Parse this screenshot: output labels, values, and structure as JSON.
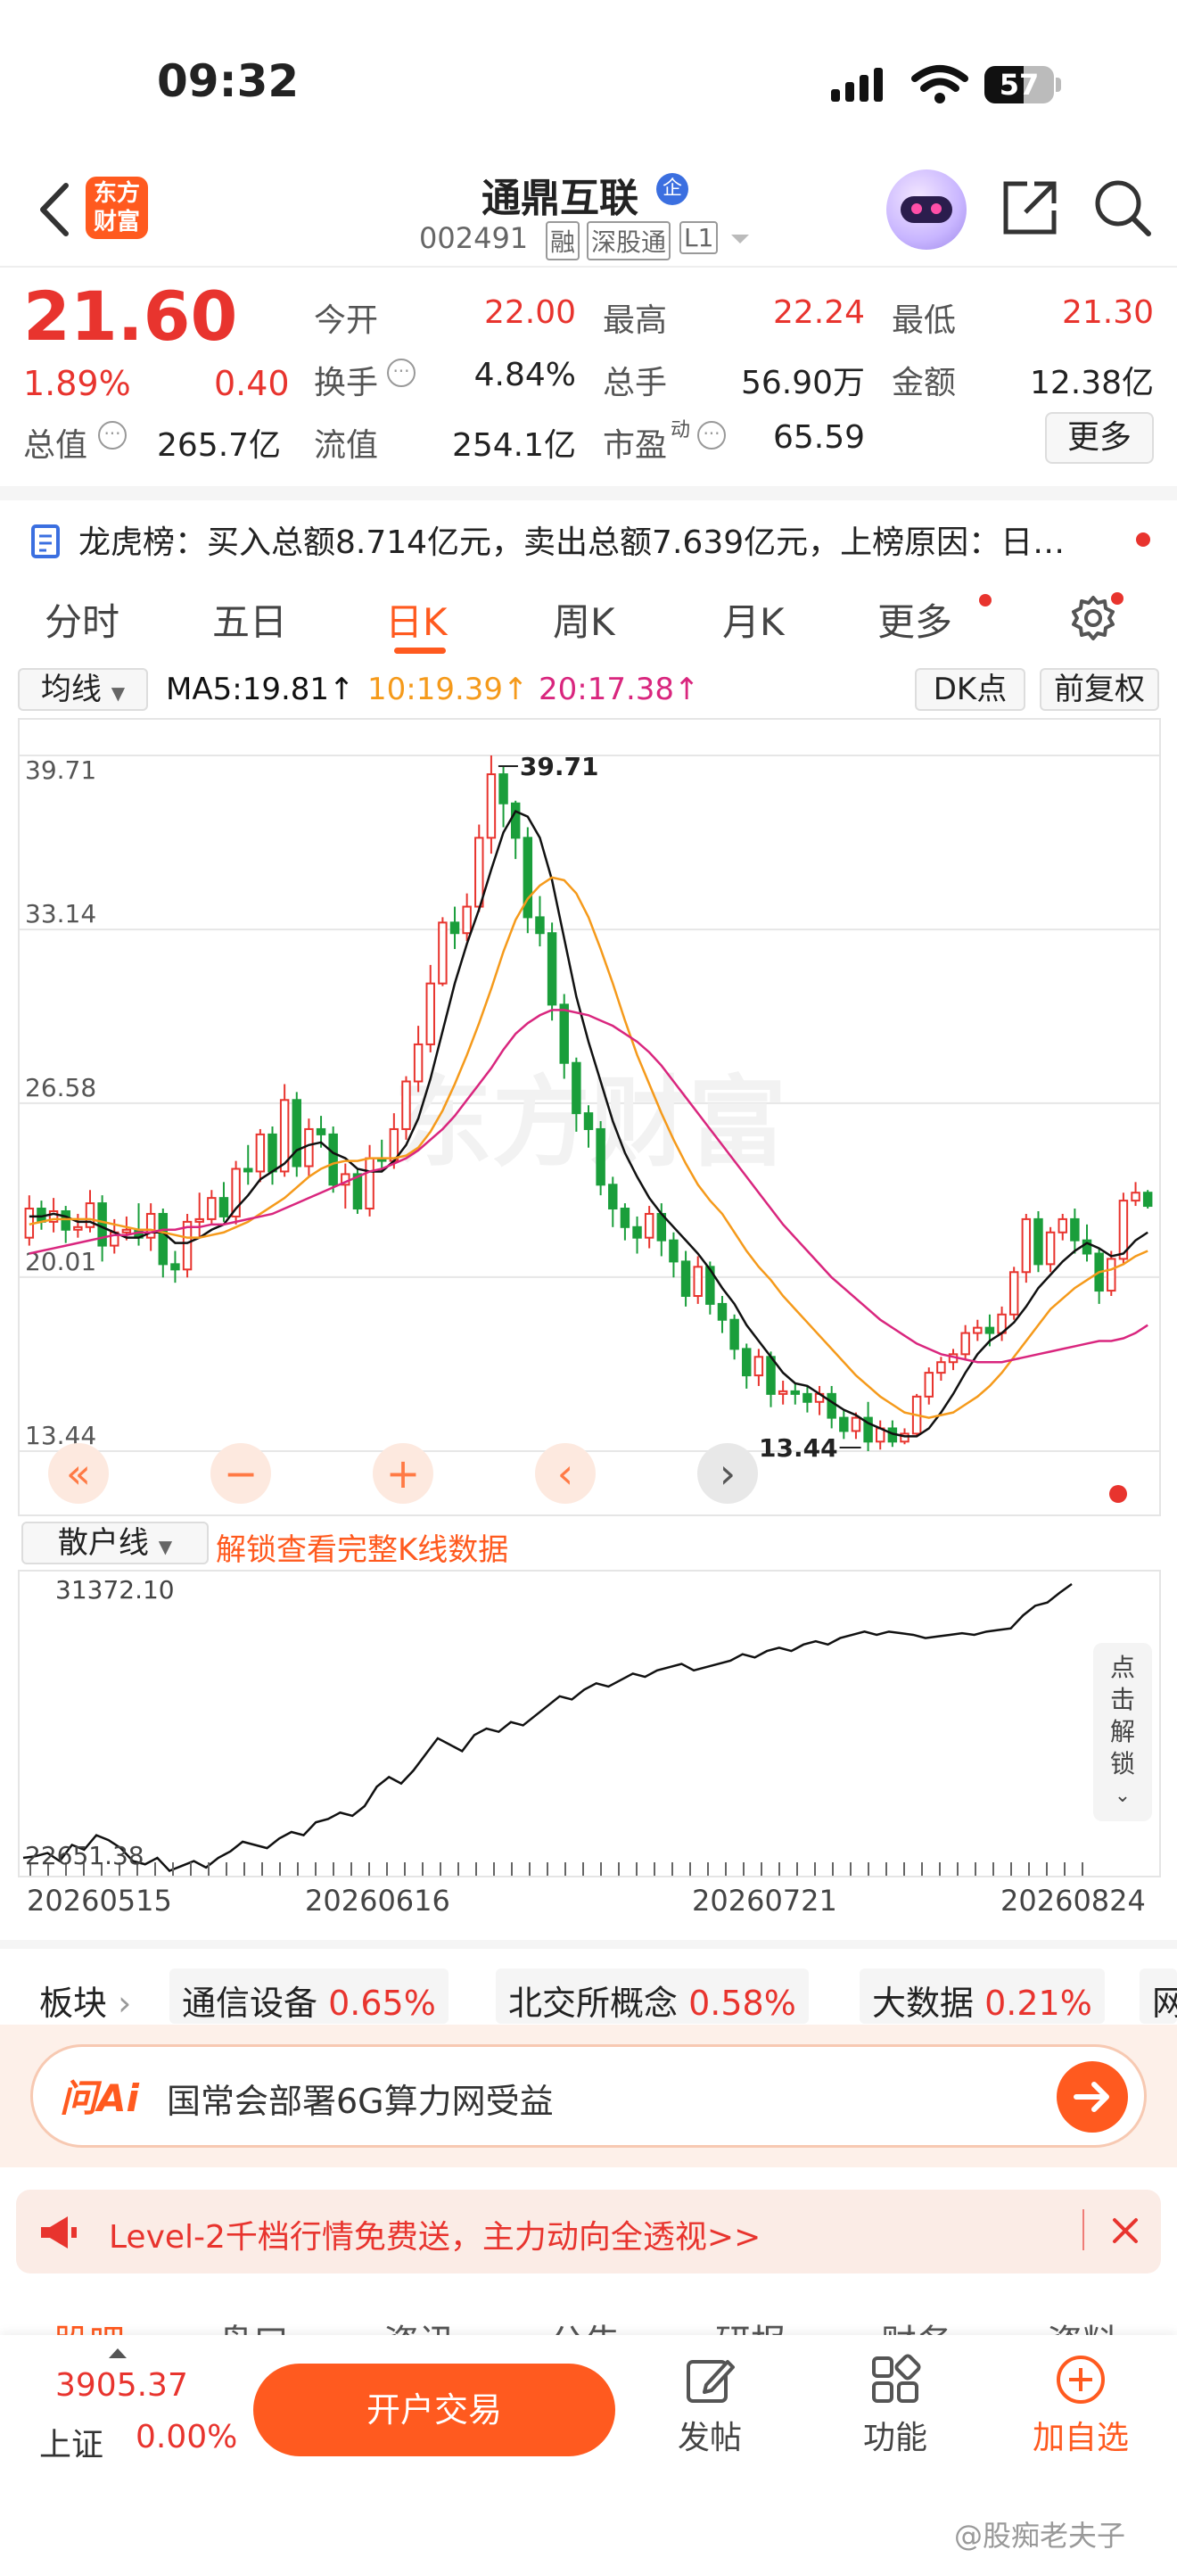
{
  "status_bar": {
    "time": "09:32",
    "battery": "57"
  },
  "header": {
    "logo_line1": "东方",
    "logo_line2": "财富",
    "stock_name": "通鼎互联",
    "qi_badge": "企",
    "code": "002491",
    "tags": [
      "融",
      "深股通",
      "L1"
    ]
  },
  "quote": {
    "price": "21.60",
    "change_pct": "1.89%",
    "change": "0.40",
    "total_value_label": "总值",
    "total_value": "265.7亿",
    "fields": [
      {
        "label": "今开",
        "value": "22.00"
      },
      {
        "label": "最高",
        "value": "22.24"
      },
      {
        "label": "最低",
        "value": "21.30"
      },
      {
        "label": "换手",
        "value": "4.84%"
      },
      {
        "label": "总手",
        "value": "56.90万"
      },
      {
        "label": "金额",
        "value": "12.38亿"
      },
      {
        "label": "流值",
        "value": "254.1亿"
      },
      {
        "label": "市盈",
        "value": "65.59"
      }
    ],
    "pe_sup": "动",
    "more": "更多"
  },
  "notice": {
    "text": "龙虎榜：买入总额8.714亿元，卖出总额7.639亿元，上榜原因：日…"
  },
  "tabs": [
    "分时",
    "五日",
    "日K",
    "周K",
    "月K",
    "更多"
  ],
  "active_tab": "日K",
  "chart_header": {
    "ma_select": "均线",
    "ma5": "MA5:19.81↑",
    "ma10": "10:19.39↑",
    "ma20": "20:17.38↑",
    "dk": "DK点",
    "adjust": "前复权"
  },
  "colors": {
    "up": "#e8342e",
    "down": "#1a9e3b",
    "ma5": "#111111",
    "ma10": "#f59a1b",
    "ma20": "#d9267e",
    "accent": "#ff5a1f"
  },
  "chart_data": {
    "type": "candlestick",
    "y_ticks": [
      "39.71",
      "33.14",
      "26.58",
      "20.01",
      "13.44"
    ],
    "ylim": [
      13.44,
      39.71
    ],
    "high_label": "39.71",
    "low_label": "13.44",
    "watermark": "东方财富",
    "candles": [
      [
        21.5,
        22.6,
        23.1,
        21.2
      ],
      [
        22.6,
        22.1,
        22.9,
        21.8
      ],
      [
        22.1,
        22.5,
        23.0,
        21.7
      ],
      [
        22.5,
        21.8,
        22.7,
        21.3
      ],
      [
        21.8,
        21.9,
        22.4,
        21.5
      ],
      [
        21.9,
        22.8,
        23.3,
        21.7
      ],
      [
        22.8,
        21.2,
        23.1,
        20.6
      ],
      [
        21.2,
        21.7,
        22.2,
        20.9
      ],
      [
        21.7,
        21.8,
        22.3,
        21.4
      ],
      [
        21.8,
        21.5,
        22.8,
        21.2
      ],
      [
        21.5,
        22.4,
        22.8,
        21.0
      ],
      [
        22.4,
        20.5,
        22.6,
        20.0
      ],
      [
        20.5,
        20.3,
        21.0,
        19.8
      ],
      [
        20.3,
        22.1,
        22.4,
        20.0
      ],
      [
        22.1,
        22.2,
        23.2,
        21.5
      ],
      [
        22.2,
        23.0,
        23.3,
        22.0
      ],
      [
        23.0,
        22.3,
        23.6,
        22.1
      ],
      [
        22.3,
        24.1,
        24.4,
        22.0
      ],
      [
        24.1,
        24.0,
        25.0,
        23.5
      ],
      [
        24.0,
        25.4,
        25.6,
        23.6
      ],
      [
        25.4,
        24.0,
        25.7,
        23.5
      ],
      [
        24.0,
        26.7,
        27.3,
        23.8
      ],
      [
        26.7,
        24.2,
        27.0,
        23.8
      ],
      [
        24.2,
        25.6,
        26.0,
        23.8
      ],
      [
        25.6,
        25.4,
        26.1,
        24.9
      ],
      [
        25.4,
        23.5,
        25.7,
        23.2
      ],
      [
        23.5,
        23.9,
        24.3,
        22.6
      ],
      [
        23.9,
        22.6,
        24.1,
        22.4
      ],
      [
        22.6,
        24.5,
        25.0,
        22.3
      ],
      [
        24.5,
        24.4,
        25.2,
        24.0
      ],
      [
        24.4,
        25.6,
        26.2,
        24.1
      ],
      [
        25.6,
        27.4,
        27.6,
        25.2
      ],
      [
        27.4,
        28.8,
        29.5,
        27.0
      ],
      [
        28.8,
        31.1,
        31.8,
        28.5
      ],
      [
        31.1,
        33.4,
        33.6,
        31.0
      ],
      [
        33.4,
        33.0,
        34.0,
        32.4
      ],
      [
        33.0,
        34.0,
        34.5,
        32.7
      ],
      [
        34.0,
        36.6,
        37.1,
        33.8
      ],
      [
        36.6,
        39.0,
        39.71,
        36.0
      ],
      [
        39.0,
        37.9,
        39.3,
        37.0
      ],
      [
        37.9,
        36.6,
        38.0,
        35.8
      ],
      [
        36.6,
        33.6,
        37.0,
        33.0
      ],
      [
        33.6,
        33.0,
        34.4,
        32.5
      ],
      [
        33.0,
        30.3,
        33.4,
        29.7
      ],
      [
        30.3,
        28.1,
        30.7,
        27.5
      ],
      [
        28.1,
        26.2,
        28.3,
        25.5
      ],
      [
        26.2,
        25.6,
        26.5,
        24.9
      ],
      [
        25.6,
        23.5,
        25.9,
        23.1
      ],
      [
        23.5,
        22.6,
        23.8,
        21.9
      ],
      [
        22.6,
        21.9,
        22.8,
        21.4
      ],
      [
        21.9,
        21.5,
        22.3,
        20.9
      ],
      [
        21.5,
        22.4,
        22.7,
        21.1
      ],
      [
        22.4,
        21.4,
        22.8,
        20.8
      ],
      [
        21.4,
        20.6,
        21.7,
        20.0
      ],
      [
        20.6,
        19.3,
        21.0,
        18.9
      ],
      [
        19.3,
        20.4,
        20.8,
        19.0
      ],
      [
        20.4,
        19.0,
        20.6,
        18.6
      ],
      [
        19.0,
        18.4,
        19.3,
        17.9
      ],
      [
        18.4,
        17.3,
        18.6,
        16.9
      ],
      [
        17.3,
        16.3,
        17.5,
        15.8
      ],
      [
        16.3,
        17.0,
        17.3,
        15.9
      ],
      [
        17.0,
        15.6,
        17.2,
        15.1
      ],
      [
        15.6,
        15.7,
        16.1,
        15.2
      ],
      [
        15.7,
        15.6,
        16.0,
        15.2
      ],
      [
        15.6,
        15.3,
        15.9,
        14.9
      ],
      [
        15.3,
        15.6,
        15.9,
        14.8
      ],
      [
        15.6,
        14.7,
        15.9,
        14.3
      ],
      [
        14.7,
        14.2,
        15.0,
        13.9
      ],
      [
        14.2,
        14.7,
        14.9,
        13.9
      ],
      [
        14.7,
        13.8,
        15.3,
        13.44
      ],
      [
        13.8,
        14.3,
        14.6,
        13.5
      ],
      [
        14.3,
        13.8,
        14.6,
        13.6
      ],
      [
        13.8,
        14.1,
        14.3,
        13.7
      ],
      [
        14.1,
        15.5,
        15.6,
        14.0
      ],
      [
        15.5,
        16.4,
        16.6,
        15.2
      ],
      [
        16.4,
        16.8,
        17.0,
        16.1
      ],
      [
        16.8,
        17.1,
        17.3,
        16.5
      ],
      [
        17.1,
        17.9,
        18.2,
        16.9
      ],
      [
        17.9,
        18.1,
        18.4,
        17.6
      ],
      [
        18.1,
        17.9,
        18.6,
        17.4
      ],
      [
        17.9,
        18.6,
        18.9,
        17.6
      ],
      [
        18.6,
        20.2,
        20.4,
        18.4
      ],
      [
        20.2,
        22.2,
        22.4,
        19.8
      ],
      [
        22.2,
        20.5,
        22.5,
        20.2
      ],
      [
        20.5,
        21.7,
        21.9,
        20.2
      ],
      [
        21.7,
        22.2,
        22.4,
        21.4
      ],
      [
        22.2,
        21.4,
        22.6,
        20.9
      ],
      [
        21.4,
        20.9,
        22.0,
        20.6
      ],
      [
        20.9,
        19.5,
        21.1,
        19.0
      ],
      [
        19.5,
        20.7,
        21.0,
        19.3
      ],
      [
        20.7,
        22.9,
        23.2,
        20.5
      ],
      [
        22.9,
        23.2,
        23.6,
        22.7
      ],
      [
        23.2,
        22.7,
        23.3,
        22.6
      ]
    ],
    "dates": [
      "20260515",
      "20260616",
      "20260721",
      "20260824"
    ],
    "series": [
      {
        "name": "MA5",
        "values": [
          22.3,
          22.3,
          22.4,
          22.3,
          22.1,
          22.1,
          21.9,
          21.7,
          21.5,
          21.5,
          21.7,
          21.7,
          21.3,
          21.3,
          21.5,
          21.8,
          22.0,
          22.6,
          23.1,
          23.7,
          24.0,
          24.3,
          24.8,
          25.0,
          25.1,
          24.7,
          24.5,
          24.1,
          24.0,
          24.0,
          24.4,
          25.0,
          26.0,
          27.5,
          29.3,
          31.1,
          32.6,
          33.9,
          35.4,
          36.8,
          37.6,
          37.4,
          36.6,
          35.0,
          32.8,
          30.6,
          28.9,
          27.4,
          25.9,
          24.7,
          23.8,
          23.0,
          22.4,
          21.9,
          21.4,
          20.9,
          20.3,
          19.6,
          19.0,
          18.2,
          17.6,
          17.0,
          16.4,
          16.0,
          15.9,
          15.6,
          15.3,
          15.0,
          14.8,
          14.5,
          14.3,
          14.1,
          14.0,
          14.0,
          14.3,
          14.9,
          15.6,
          16.4,
          17.1,
          17.6,
          17.9,
          18.3,
          18.9,
          19.6,
          20.1,
          20.6,
          21.0,
          21.3,
          21.1,
          20.8,
          20.9,
          21.4,
          21.7
        ]
      },
      {
        "name": "MA10",
        "values": [
          22.0,
          22.1,
          22.2,
          22.2,
          22.2,
          22.2,
          22.1,
          22.0,
          21.9,
          21.8,
          21.8,
          21.7,
          21.6,
          21.5,
          21.5,
          21.6,
          21.7,
          21.9,
          22.1,
          22.4,
          22.7,
          23.0,
          23.4,
          23.8,
          24.1,
          24.3,
          24.4,
          24.4,
          24.5,
          24.5,
          24.5,
          24.6,
          24.9,
          25.5,
          26.3,
          27.3,
          28.4,
          29.6,
          30.9,
          32.3,
          33.5,
          34.3,
          34.8,
          35.1,
          35.0,
          34.5,
          33.6,
          32.4,
          31.1,
          29.7,
          28.4,
          27.3,
          26.2,
          25.2,
          24.3,
          23.5,
          22.9,
          22.4,
          21.7,
          21.0,
          20.4,
          19.9,
          19.3,
          18.8,
          18.3,
          17.8,
          17.3,
          16.8,
          16.3,
          15.9,
          15.5,
          15.2,
          14.9,
          14.8,
          14.7,
          14.8,
          14.9,
          15.2,
          15.5,
          15.9,
          16.4,
          17.0,
          17.6,
          18.2,
          18.8,
          19.2,
          19.6,
          19.9,
          20.2,
          20.3,
          20.5,
          20.8,
          21.0
        ]
      },
      {
        "name": "MA20",
        "values": [
          20.9,
          21.0,
          21.1,
          21.2,
          21.3,
          21.4,
          21.5,
          21.6,
          21.6,
          21.7,
          21.7,
          21.8,
          21.8,
          21.9,
          21.9,
          22.0,
          22.0,
          22.1,
          22.2,
          22.3,
          22.4,
          22.6,
          22.8,
          23.0,
          23.2,
          23.4,
          23.6,
          23.8,
          24.0,
          24.1,
          24.3,
          24.5,
          24.8,
          25.2,
          25.6,
          26.1,
          26.7,
          27.3,
          27.9,
          28.6,
          29.2,
          29.6,
          29.9,
          30.1,
          30.1,
          30.0,
          29.9,
          29.7,
          29.5,
          29.2,
          28.9,
          28.5,
          28.0,
          27.4,
          26.8,
          26.2,
          25.6,
          25.0,
          24.4,
          23.8,
          23.2,
          22.6,
          22.0,
          21.5,
          21.0,
          20.5,
          20.0,
          19.6,
          19.2,
          18.8,
          18.4,
          18.1,
          17.8,
          17.5,
          17.3,
          17.1,
          17.0,
          16.9,
          16.8,
          16.8,
          16.8,
          16.9,
          17.0,
          17.1,
          17.2,
          17.3,
          17.4,
          17.5,
          17.6,
          17.6,
          17.7,
          17.9,
          18.2
        ]
      }
    ]
  },
  "retail_panel": {
    "select": "散户线",
    "unlock_text": "解锁查看完整K线数据",
    "y_max": "31372.10",
    "y_min": "22651.38",
    "side_unlock": [
      "点",
      "击",
      "解",
      "锁"
    ],
    "values": [
      22900,
      22950,
      23050,
      22800,
      23300,
      23150,
      23600,
      23450,
      23200,
      22800,
      22700,
      22900,
      22500,
      22650,
      22800,
      22600,
      22900,
      23100,
      23400,
      23300,
      23200,
      23500,
      23700,
      23600,
      24000,
      24100,
      24300,
      24200,
      24500,
      25100,
      25400,
      25200,
      25600,
      26100,
      26600,
      26400,
      26200,
      26700,
      26900,
      26800,
      27100,
      27000,
      27300,
      27600,
      27900,
      27800,
      28100,
      28300,
      28200,
      28400,
      28600,
      28500,
      28700,
      28800,
      28900,
      28700,
      28800,
      28900,
      29000,
      29200,
      29100,
      29300,
      29400,
      29300,
      29500,
      29600,
      29500,
      29700,
      29800,
      29900,
      29800,
      29900,
      29850,
      29800,
      29700,
      29750,
      29800,
      29850,
      29800,
      29900,
      29950,
      30000,
      30400,
      30700,
      30800,
      31100,
      31372
    ]
  },
  "sectors": {
    "label": "板块",
    "items": [
      {
        "name": "通信设备",
        "pct": "0.65%"
      },
      {
        "name": "北交所概念",
        "pct": "0.58%"
      },
      {
        "name": "大数据",
        "pct": "0.21%"
      },
      {
        "name": "网",
        "pct": ""
      }
    ]
  },
  "ai": {
    "brand": "问Ai",
    "text": "国常会部署6G算力网受益"
  },
  "level2": {
    "text": "Level-2千档行情免费送，主力动向全透视>>"
  },
  "bottom_tabs": [
    "股吧",
    "盘口",
    "资讯",
    "公告",
    "研报",
    "财务",
    "资料"
  ],
  "dock": {
    "index_value": "3905.37",
    "index_name": "上证",
    "index_pct": "0.00%",
    "trade_button": "开户交易",
    "post": "发帖",
    "func": "功能",
    "add": "加自选"
  },
  "watermark_footer": "@股痴老夫子"
}
